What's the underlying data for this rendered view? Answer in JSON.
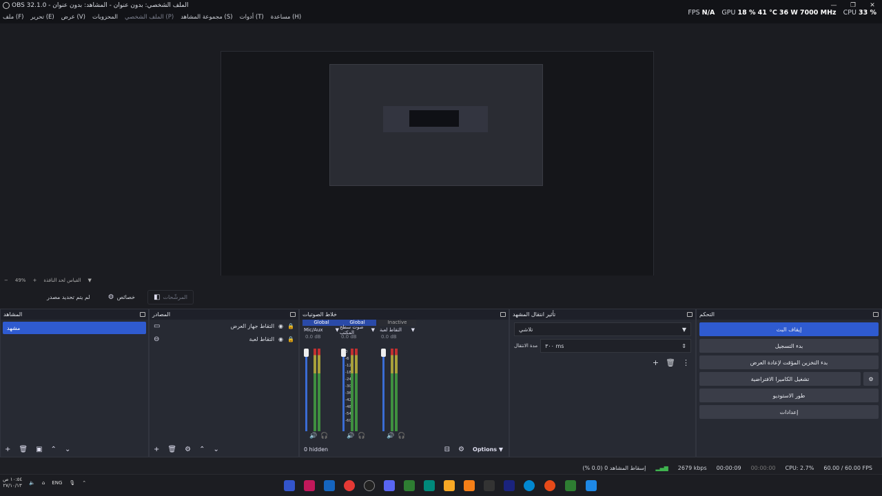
{
  "window": {
    "title": "OBS 32.1.0 - الملف الشخصي: بدون عنوان - المشاهد: بدون عنوان",
    "minimize": "—",
    "maximize": "❐",
    "close": "✕"
  },
  "menu": [
    "ملف (F)",
    "تحرير (E)",
    "عرض (V)",
    "المحزوبات",
    "الملف الشخصي (P)",
    "مجموعة المشاهد (S)",
    "أدوات (T)",
    "مساعدة (H)"
  ],
  "stats": {
    "fps_label": "FPS",
    "fps_value": "N/A",
    "gpu_label": "GPU",
    "gpu_usage": "18 %",
    "gpu_temp": "41 °C",
    "gpu_power": "36 W",
    "gpu_clock": "7000 MHz",
    "cpu_label": "CPU",
    "cpu_value": "33 %"
  },
  "zoom": {
    "value": "49%",
    "minus": "−",
    "plus": "+",
    "label": "القياس لحد النافذة"
  },
  "toolbar": {
    "no_source": "لم يتم تحديد مصدر",
    "properties": "خصائص",
    "filters": "المرشّحات"
  },
  "docks": {
    "scenes": {
      "title": "المشاهد",
      "items": [
        "مشهد"
      ]
    },
    "sources": {
      "title": "المصادر",
      "items": [
        "التقاط جهاز العرض",
        "التقاط لعبة"
      ]
    },
    "mixer": {
      "title": "خلاط الصوتيات",
      "channels": [
        {
          "header": "Global",
          "name": "Mic/Aux",
          "db": "0.0 dB",
          "header_color": "#2a4aa8"
        },
        {
          "header": "Global",
          "name": "صوت سطح المكتب",
          "db": "0.0 dB",
          "header_color": "#2a4aa8"
        },
        {
          "header": "Inactive",
          "name": "التقاط لعبة",
          "db": "0.0 dB",
          "header_color": "#2a2c33"
        }
      ],
      "ticks": [
        "0",
        "-6",
        "-12",
        "-18",
        "-24",
        "-30",
        "-36",
        "-42",
        "-48",
        "-54",
        "-60"
      ],
      "hidden": "0 hidden",
      "options": "Options"
    },
    "transitions": {
      "title": "تأثير انتقال المشهد",
      "selected": "تلاشي",
      "duration_label": "مدة الانتقال",
      "duration_value": "٣٠٠ ms"
    },
    "controls": {
      "title": "التحكم",
      "buttons": [
        "إيقاف البث",
        "بدء التسجيل",
        "بدء التخزين المؤقت لإعادة العرض",
        "تشغيل الكاميرا الافتراضية",
        "طور الاستوديو",
        "إعدادات"
      ]
    }
  },
  "status": {
    "dropped": "إسقاط المشاهد 0 (0.0 %)",
    "bitrate": "2679 kbps",
    "stream_time": "00:00:09",
    "rec_time": "00:00:00",
    "cpu": "CPU: 2.7%",
    "fps": "60.00 / 60.00 FPS"
  },
  "taskbar": {
    "time": "١٠:٥٤ ص",
    "date": "٢٧/١٠/١٣",
    "lang": "ENG"
  }
}
